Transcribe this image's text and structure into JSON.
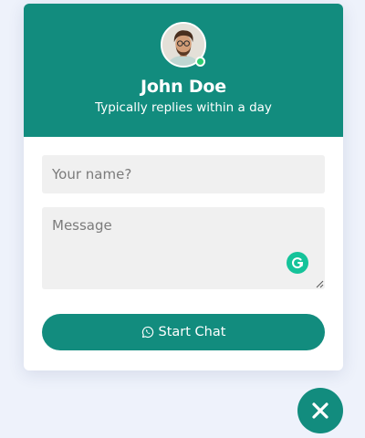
{
  "colors": {
    "brand": "#128c7e",
    "online": "#2ecc71",
    "grammarly": "#15c39a",
    "page_background": "#eef2fb"
  },
  "header": {
    "name": "John Doe",
    "subtitle": "Typically replies within a day",
    "avatar_icon": "user-photo",
    "status": "online"
  },
  "form": {
    "name_placeholder": "Your name?",
    "name_value": "",
    "message_placeholder": "Message",
    "message_value": "",
    "start_chat_label": "Start Chat",
    "start_chat_icon": "whatsapp-icon",
    "grammarly_icon": "grammarly-icon"
  },
  "close_button": {
    "icon": "close-icon"
  }
}
